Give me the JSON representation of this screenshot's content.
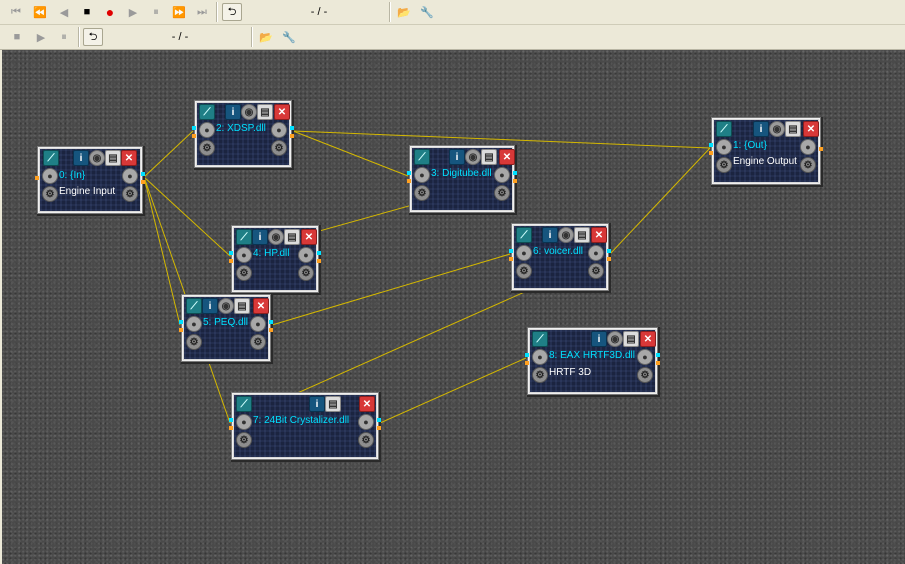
{
  "toolbar1": {
    "position_text": "- / -",
    "buttons": [
      {
        "name": "skip-start-button",
        "glyph": "⏮",
        "active": false
      },
      {
        "name": "rewind-button",
        "glyph": "⏪",
        "active": false
      },
      {
        "name": "step-back-button",
        "glyph": "◀",
        "active": false
      },
      {
        "name": "stop-button",
        "glyph": "■",
        "active": true
      },
      {
        "name": "record-button",
        "glyph": "●",
        "active": true,
        "record": true
      },
      {
        "name": "play-button",
        "glyph": "▶",
        "active": false
      },
      {
        "name": "pause-button",
        "glyph": "⏸",
        "active": false
      },
      {
        "name": "fast-forward-button",
        "glyph": "⏩",
        "active": false
      },
      {
        "name": "skip-end-button",
        "glyph": "⏭",
        "active": false
      },
      {
        "name": "loop-button",
        "glyph": "⮌",
        "active": true,
        "boxed": true
      },
      {
        "name": "open-folder-button",
        "glyph": "📂",
        "active": true
      },
      {
        "name": "settings-button",
        "glyph": "🔧",
        "active": true
      }
    ]
  },
  "toolbar2": {
    "position_text": "- / -",
    "buttons": [
      {
        "name": "stop-button-2",
        "glyph": "■",
        "active": false
      },
      {
        "name": "play-button-2",
        "glyph": "▶",
        "active": false
      },
      {
        "name": "pause-button-2",
        "glyph": "⏸",
        "active": false
      },
      {
        "name": "loop-button-2",
        "glyph": "⮌",
        "active": true,
        "boxed": true
      },
      {
        "name": "open-folder-button-2",
        "glyph": "📂",
        "active": true
      },
      {
        "name": "settings-button-2",
        "glyph": "🔧",
        "active": true
      }
    ]
  },
  "nodes": [
    {
      "id": "in",
      "label1": "0: {In}",
      "label2": "Engine Input"
    },
    {
      "id": "xdsp",
      "label1": "2: XDSP.dll",
      "label2": ""
    },
    {
      "id": "digitube",
      "label1": "3: Digitube.dll",
      "label2": ""
    },
    {
      "id": "hp",
      "label1": "4: HP.dll",
      "label2": ""
    },
    {
      "id": "peq",
      "label1": "5: PEQ.dll",
      "label2": ""
    },
    {
      "id": "voicer",
      "label1": "6: voicer.dll",
      "label2": ""
    },
    {
      "id": "crystalizer",
      "label1": "7: 24Bit Crystalizer.dll",
      "label2": ""
    },
    {
      "id": "eax",
      "label1": "8: EAX HRTF3D.dll",
      "label2": "HRTF 3D"
    },
    {
      "id": "out",
      "label1": "1: {Out}",
      "label2": "Engine Output"
    }
  ],
  "connections": [
    [
      "in",
      "xdsp"
    ],
    [
      "in",
      "hp"
    ],
    [
      "in",
      "peq"
    ],
    [
      "in",
      "crystalizer"
    ],
    [
      "xdsp",
      "out"
    ],
    [
      "xdsp",
      "digitube"
    ],
    [
      "digitube",
      "hp"
    ],
    [
      "peq",
      "voicer"
    ],
    [
      "voicer",
      "out"
    ],
    [
      "voicer",
      "crystalizer"
    ],
    [
      "crystalizer",
      "eax"
    ]
  ],
  "colors": {
    "wire": "#d4b800",
    "label_name": "#00e0ff",
    "label_desc": "#ffffff",
    "workspace": "#4a4a4a"
  }
}
